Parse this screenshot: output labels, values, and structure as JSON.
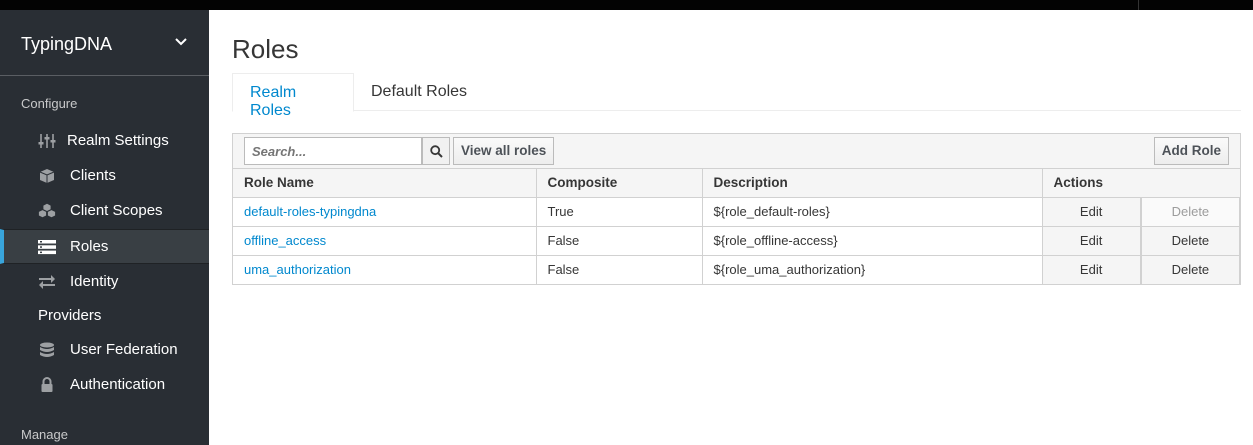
{
  "sidebar": {
    "realm_name": "TypingDNA",
    "section_configure": "Configure",
    "section_manage": "Manage",
    "items": [
      {
        "label": "Realm Settings",
        "icon": "sliders-icon"
      },
      {
        "label": "Clients",
        "icon": "cube-icon"
      },
      {
        "label": "Client Scopes",
        "icon": "cubes-icon"
      },
      {
        "label": "Roles",
        "icon": "list-icon"
      },
      {
        "label": "Identity",
        "label2": "Providers",
        "icon": "exchange-icon"
      },
      {
        "label": "User Federation",
        "icon": "database-icon"
      },
      {
        "label": "Authentication",
        "icon": "lock-icon"
      }
    ]
  },
  "main": {
    "title": "Roles",
    "tabs": [
      {
        "label": "Realm Roles"
      },
      {
        "label": "Default Roles"
      }
    ],
    "search": {
      "placeholder": "Search..."
    },
    "view_all_label": "View all roles",
    "add_role_label": "Add Role",
    "columns": [
      "Role Name",
      "Composite",
      "Description",
      "Actions"
    ],
    "rows": [
      {
        "name": "default-roles-typingdna",
        "composite": "True",
        "description": "${role_default-roles}",
        "edit": "Edit",
        "delete": "Delete"
      },
      {
        "name": "offline_access",
        "composite": "False",
        "description": "${role_offline-access}",
        "edit": "Edit",
        "delete": "Delete"
      },
      {
        "name": "uma_authorization",
        "composite": "False",
        "description": "${role_uma_authorization}",
        "edit": "Edit",
        "delete": "Delete"
      }
    ]
  },
  "colors": {
    "sidebar_bg": "#292e34",
    "active_accent": "#39a5dc",
    "link": "#0088ce"
  }
}
